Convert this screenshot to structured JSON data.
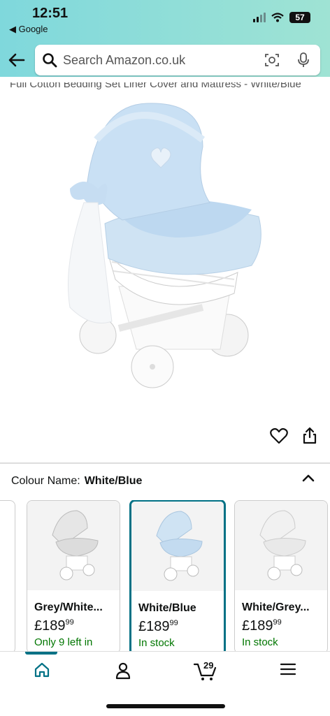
{
  "status_bar": {
    "time": "12:51",
    "back_app": "◀ Google",
    "battery": "57"
  },
  "search": {
    "placeholder": "Search Amazon.co.uk"
  },
  "product": {
    "title_fragment": "Full Cotton Bedding Set Liner Cover and Mattress - White/Blue"
  },
  "colour": {
    "label": "Colour Name:",
    "selected": "White/Blue"
  },
  "variants": [
    {
      "name": "Grey/White...",
      "price_whole": "£189",
      "price_fraction": "99",
      "stock": "Only 9 left in",
      "selected": false
    },
    {
      "name": "White/Blue",
      "price_whole": "£189",
      "price_fraction": "99",
      "stock": "In stock",
      "selected": true
    },
    {
      "name": "White/Grey...",
      "price_whole": "£189",
      "price_fraction": "99",
      "stock": "In stock",
      "selected": false
    }
  ],
  "tabbar": {
    "cart_count": "29"
  },
  "colors": {
    "header": "#8fdcd8",
    "accent": "#007185",
    "in_stock": "#007600"
  }
}
